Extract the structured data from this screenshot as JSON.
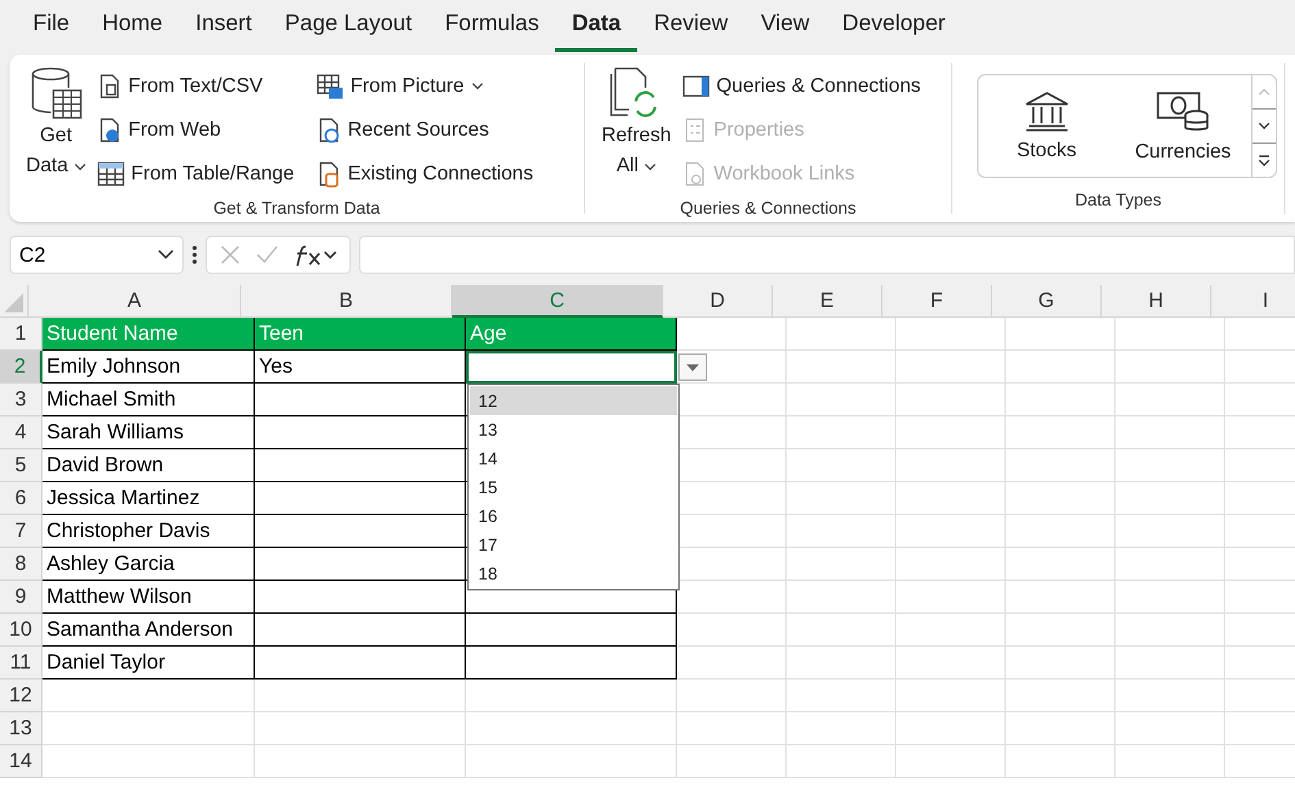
{
  "menu_tabs": [
    {
      "label": "File",
      "selected": false
    },
    {
      "label": "Home",
      "selected": false
    },
    {
      "label": "Insert",
      "selected": false
    },
    {
      "label": "Page Layout",
      "selected": false
    },
    {
      "label": "Formulas",
      "selected": false
    },
    {
      "label": "Data",
      "selected": true
    },
    {
      "label": "Review",
      "selected": false
    },
    {
      "label": "View",
      "selected": false
    },
    {
      "label": "Developer",
      "selected": false
    }
  ],
  "get_transform": {
    "title": "Get & Transform Data",
    "big_lines": [
      "Get",
      "Data"
    ],
    "items": [
      {
        "label": "From Text/CSV",
        "kind": "text",
        "has_menu": false
      },
      {
        "label": "From Web",
        "kind": "web",
        "has_menu": false
      },
      {
        "label": "From Table/Range",
        "kind": "table",
        "has_menu": false
      },
      {
        "label": "From Picture",
        "kind": "picture",
        "has_menu": true
      },
      {
        "label": "Recent Sources",
        "kind": "recent",
        "has_menu": false
      },
      {
        "label": "Existing Connections",
        "kind": "existing",
        "has_menu": false
      }
    ]
  },
  "queries": {
    "title": "Queries & Connections",
    "big_lines": [
      "Refresh",
      "All"
    ],
    "items": [
      {
        "label": "Queries & Connections",
        "kind": "queries",
        "disabled": false
      },
      {
        "label": "Properties",
        "kind": "properties",
        "disabled": true
      },
      {
        "label": "Workbook Links",
        "kind": "links",
        "disabled": true
      }
    ]
  },
  "data_types": {
    "title": "Data Types",
    "items": [
      {
        "label": "Stocks",
        "kind": "stocks"
      },
      {
        "label": "Currencies",
        "kind": "currencies"
      }
    ]
  },
  "formula_bar": {
    "name_box": "C2"
  },
  "sheet": {
    "columns": [
      {
        "label": "A",
        "selected": false
      },
      {
        "label": "B",
        "selected": false
      },
      {
        "label": "C",
        "selected": true
      },
      {
        "label": "D",
        "selected": false
      },
      {
        "label": "E",
        "selected": false
      },
      {
        "label": "F",
        "selected": false
      },
      {
        "label": "G",
        "selected": false
      },
      {
        "label": "H",
        "selected": false
      },
      {
        "label": "I",
        "selected": false
      }
    ],
    "rows": [
      {
        "number": "1",
        "selected": false,
        "kind": "header",
        "cells": [
          "Student Name",
          "Teen",
          "Age"
        ]
      },
      {
        "number": "2",
        "selected": true,
        "kind": "data",
        "cells": [
          "Emily Johnson",
          "Yes"
        ]
      },
      {
        "number": "3",
        "selected": false,
        "kind": "data",
        "cells": [
          "Michael Smith"
        ]
      },
      {
        "number": "4",
        "selected": false,
        "kind": "data",
        "cells": [
          "Sarah Williams"
        ]
      },
      {
        "number": "5",
        "selected": false,
        "kind": "data",
        "cells": [
          "David Brown"
        ]
      },
      {
        "number": "6",
        "selected": false,
        "kind": "data",
        "cells": [
          "Jessica Martinez"
        ]
      },
      {
        "number": "7",
        "selected": false,
        "kind": "data",
        "cells": [
          "Christopher Davis"
        ]
      },
      {
        "number": "8",
        "selected": false,
        "kind": "data",
        "cells": [
          "Ashley Garcia"
        ]
      },
      {
        "number": "9",
        "selected": false,
        "kind": "data",
        "cells": [
          "Matthew Wilson"
        ]
      },
      {
        "number": "10",
        "selected": false,
        "kind": "data",
        "cells": [
          "Samantha Anderson"
        ]
      },
      {
        "number": "11",
        "selected": false,
        "kind": "data",
        "cells": [
          "Daniel Taylor"
        ]
      },
      {
        "number": "12",
        "selected": false,
        "kind": "blank"
      },
      {
        "number": "13",
        "selected": false,
        "kind": "blank"
      },
      {
        "number": "14",
        "selected": false,
        "kind": "blank"
      }
    ],
    "dropdown": {
      "options": [
        {
          "label": "12",
          "selected": true
        },
        {
          "label": "13",
          "selected": false
        },
        {
          "label": "14",
          "selected": false
        },
        {
          "label": "15",
          "selected": false
        },
        {
          "label": "16",
          "selected": false
        },
        {
          "label": "17",
          "selected": false
        },
        {
          "label": "18",
          "selected": false
        }
      ]
    }
  }
}
